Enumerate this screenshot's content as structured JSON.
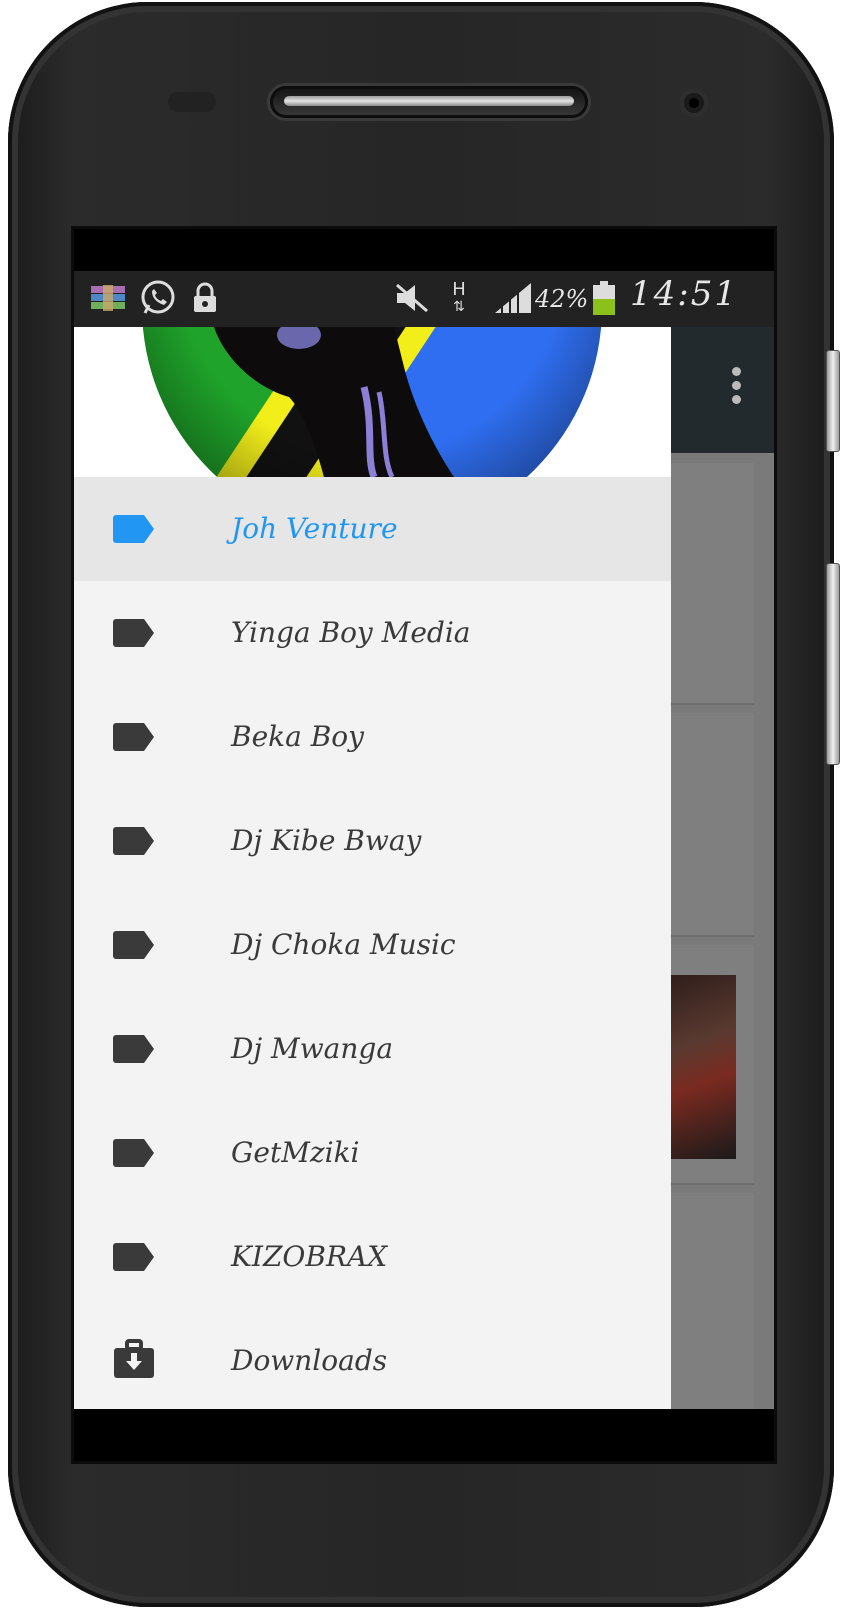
{
  "status_bar": {
    "battery_percent": "42%",
    "time": "14:51",
    "network_type": "H",
    "icons": [
      "winrar-icon",
      "whatsapp-icon",
      "lock-icon",
      "mute-icon",
      "data-arrows-icon",
      "signal-icon",
      "battery-icon"
    ]
  },
  "drawer": {
    "header_image": "tanzania-flag-silhouette",
    "items": [
      {
        "label": "Joh Venture",
        "icon": "label-icon",
        "active": true
      },
      {
        "label": "Yinga Boy Media",
        "icon": "label-icon",
        "active": false
      },
      {
        "label": "Beka Boy",
        "icon": "label-icon",
        "active": false
      },
      {
        "label": "Dj Kibe Bway",
        "icon": "label-icon",
        "active": false
      },
      {
        "label": "Dj Choka Music",
        "icon": "label-icon",
        "active": false
      },
      {
        "label": "Dj Mwanga",
        "icon": "label-icon",
        "active": false
      },
      {
        "label": "GetMziki",
        "icon": "label-icon",
        "active": false
      },
      {
        "label": "KIZOBRAX",
        "icon": "label-icon",
        "active": false
      },
      {
        "label": "Downloads",
        "icon": "download-briefcase-icon",
        "active": false
      }
    ]
  },
  "colors": {
    "accent": "#2196f3",
    "icon_default": "#3a3a3a",
    "toolbar": "#222a2e",
    "drawer_background": "#f3f3f3",
    "active_row": "#e6e6e6"
  }
}
